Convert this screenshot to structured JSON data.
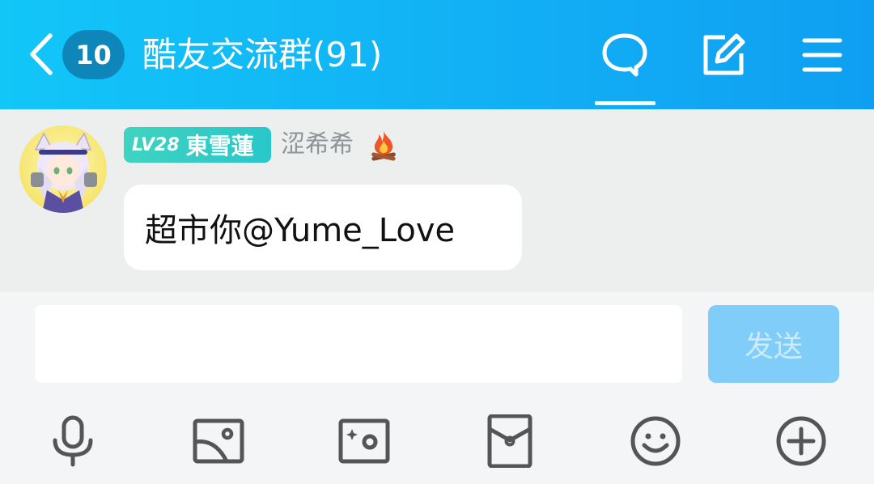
{
  "header": {
    "unread_count": "10",
    "title": "酷友交流群(91)",
    "tabs": [
      {
        "icon": "chat-bubble-icon",
        "active": true
      },
      {
        "icon": "edit-icon",
        "active": false
      },
      {
        "icon": "menu-icon",
        "active": false
      }
    ],
    "background_color": "#12b0f5"
  },
  "messages": [
    {
      "level": "LV28",
      "nickname": "東雪蓮",
      "sender": "涩希希",
      "badge_icon": "fire-icon",
      "text": "超市你@Yume_Love"
    }
  ],
  "composer": {
    "input_value": "",
    "send_label": "发送",
    "send_color": "#7fcdf8",
    "tools": [
      "microphone-icon",
      "image-icon",
      "camera-icon",
      "red-packet-icon",
      "emoji-icon",
      "plus-icon"
    ]
  }
}
